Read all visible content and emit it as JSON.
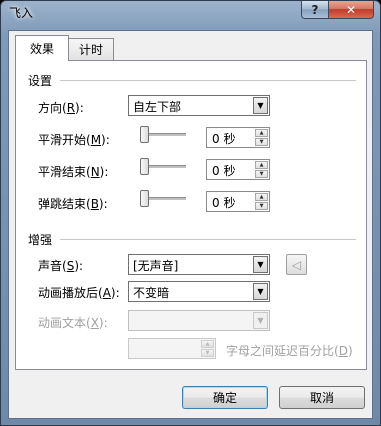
{
  "window": {
    "title": "飞入",
    "help_label": "?",
    "close_label": "✕"
  },
  "tabs": [
    {
      "label": "效果",
      "active": true
    },
    {
      "label": "计时",
      "active": false
    }
  ],
  "settings": {
    "group_title": "设置",
    "direction": {
      "label": "方向(",
      "key": "R",
      "suffix": "):",
      "value": "自左下部"
    },
    "smooth_start": {
      "label": "平滑开始(",
      "key": "M",
      "suffix": "):",
      "value": "0 秒",
      "slider_level": 0
    },
    "smooth_end": {
      "label": "平滑结束(",
      "key": "N",
      "suffix": "):",
      "value": "0 秒",
      "slider_level": 0
    },
    "bounce_end": {
      "label": "弹跳结束(",
      "key": "B",
      "suffix": "):",
      "value": "0 秒",
      "slider_level": 0
    }
  },
  "enhance": {
    "group_title": "增强",
    "sound": {
      "label": "声音(",
      "key": "S",
      "suffix": "):",
      "value": "[无声音]"
    },
    "after_animation": {
      "label": "动画播放后(",
      "key": "A",
      "suffix": "):",
      "value": "不变暗"
    },
    "animate_text": {
      "label": "动画文本(",
      "key": "X",
      "suffix": "):",
      "value": ""
    },
    "letter_delay": {
      "value": "",
      "label": "字母之间延迟百分比(",
      "key": "D",
      "suffix": ")"
    }
  },
  "buttons": {
    "ok": "确定",
    "cancel": "取消"
  },
  "icons": {
    "dropdown": "triangle-down",
    "spin_up": "triangle-up",
    "spin_down": "triangle-down",
    "sound": "speaker"
  }
}
